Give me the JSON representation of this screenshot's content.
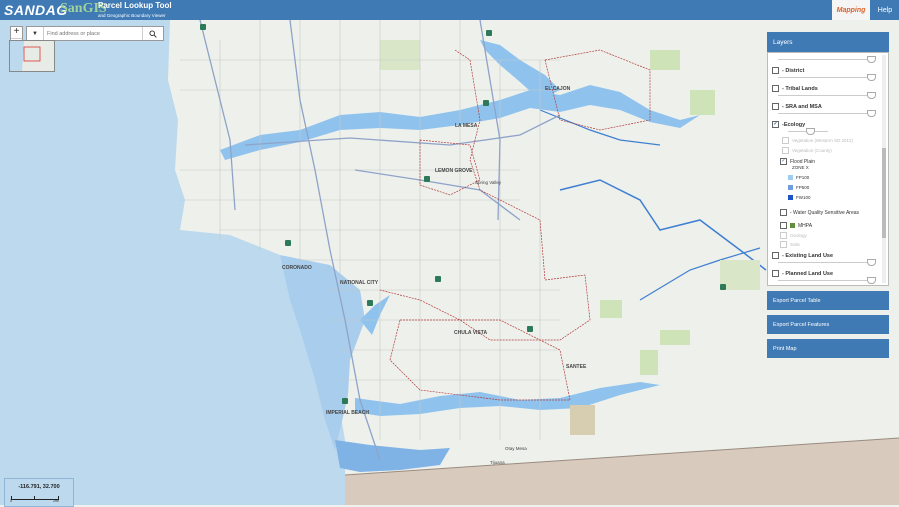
{
  "header": {
    "logo_sandag": "SANDAG",
    "logo_sangis": "SanGIS",
    "title": "Parcel Lookup Tool",
    "subtitle": "and Geographic Boundary Viewer",
    "mapping_label": "Mapping",
    "help_label": "Help"
  },
  "search": {
    "placeholder": "Find address or place"
  },
  "panel": {
    "title": "Layers",
    "layers": [
      {
        "label": "- District",
        "checked": false
      },
      {
        "label": "- Tribal Lands",
        "checked": false
      },
      {
        "label": "- SRA and MSA",
        "checked": false
      },
      {
        "label": "-Ecology",
        "checked": true
      }
    ],
    "ecology_sublayers": [
      {
        "label": "Vegetation (Western SD 2012)"
      },
      {
        "label": "Vegetation (County)"
      },
      {
        "label": "Flood Plain"
      },
      {
        "label": "ZONE X"
      },
      {
        "label": "FP100"
      },
      {
        "label": "FP500"
      },
      {
        "label": "FW100"
      }
    ],
    "more_layers": [
      {
        "label": "- Water Quality Sensitive Areas"
      },
      {
        "label": "MHPA"
      },
      {
        "label": "Geology"
      },
      {
        "label": "Soils"
      },
      {
        "label": "- Existing Land Use"
      },
      {
        "label": "- Planned Land Use"
      }
    ],
    "actions": [
      "Export Parcel Table",
      "Export Parcel Features",
      "Print Map"
    ]
  },
  "map": {
    "places": [
      "LA MESA",
      "LEMON GROVE",
      "NATIONAL CITY",
      "CHULA VISTA",
      "CORONADO",
      "IMPERIAL BEACH",
      "SANTEE",
      "EL CAJON",
      "Spring Valley",
      "Otay Mesa",
      "Tijuana"
    ]
  },
  "coords": {
    "value": "-116.791, 32.700",
    "scale_left": "0",
    "scale_right": "2mi"
  },
  "colors": {
    "header": "#3f7ab5",
    "flood_fill": "#8fc3ee",
    "ocean": "#bcd9ee",
    "mexico": "#d8cbbd"
  }
}
